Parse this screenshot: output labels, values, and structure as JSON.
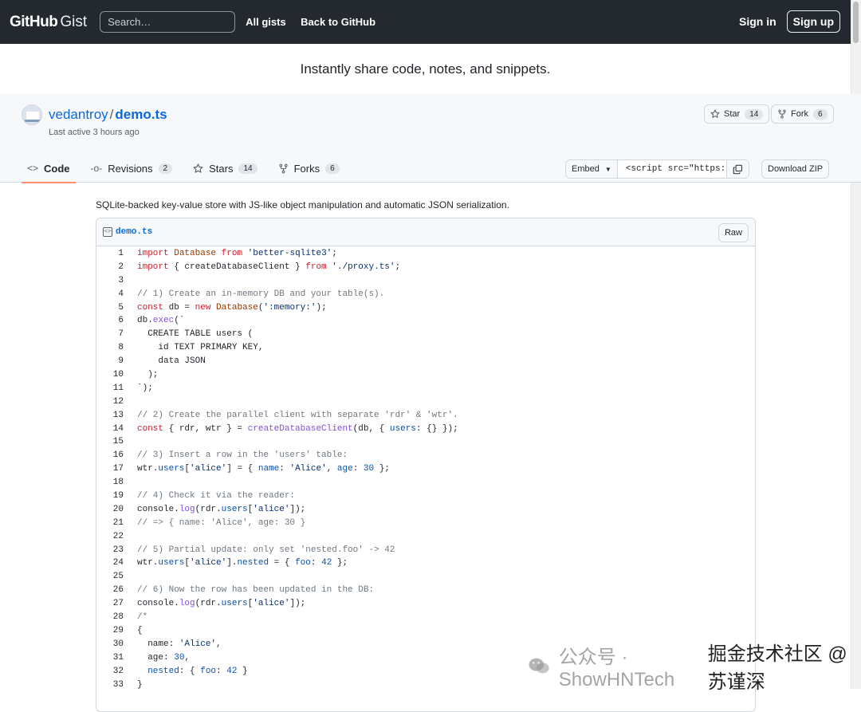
{
  "header": {
    "logo_main": "GitHub",
    "logo_sub": "Gist",
    "search_placeholder": "Search…",
    "nav": [
      "All gists",
      "Back to GitHub"
    ],
    "sign_in": "Sign in",
    "sign_up": "Sign up"
  },
  "tagline": "Instantly share code, notes, and snippets.",
  "gist": {
    "owner": "vedantroy",
    "separator": "/",
    "filename": "demo.ts",
    "last_active": "Last active 3 hours ago",
    "star_label": "Star",
    "star_count": "14",
    "fork_label": "Fork",
    "fork_count": "6"
  },
  "tabs": [
    {
      "label": "Code",
      "icon": "code-icon",
      "count": ""
    },
    {
      "label": "Revisions",
      "icon": "commit-icon",
      "count": "2"
    },
    {
      "label": "Stars",
      "icon": "star-icon",
      "count": "14"
    },
    {
      "label": "Forks",
      "icon": "fork-icon",
      "count": "6"
    }
  ],
  "embed": {
    "select_label": "Embed",
    "url": "<script src=\"https:/",
    "download_label": "Download ZIP"
  },
  "description": "SQLite-backed key-value store with JS-like object manipulation and automatic JSON serialization.",
  "file": {
    "name": "demo.ts",
    "raw_label": "Raw"
  },
  "code_lines": [
    "import Database from 'better-sqlite3';",
    "import { createDatabaseClient } from './proxy.ts';",
    "",
    "// 1) Create an in-memory DB and your table(s).",
    "const db = new Database(':memory:');",
    "db.exec(`",
    "  CREATE TABLE users (",
    "    id TEXT PRIMARY KEY,",
    "    data JSON",
    "  );",
    "`);",
    "",
    "// 2) Create the parallel client with separate 'rdr' & 'wtr'.",
    "const { rdr, wtr } = createDatabaseClient(db, { users: {} });",
    "",
    "// 3) Insert a row in the 'users' table:",
    "wtr.users['alice'] = { name: 'Alice', age: 30 };",
    "",
    "// 4) Check it via the reader:",
    "console.log(rdr.users['alice']);",
    "// => { name: 'Alice', age: 30 }",
    "",
    "// 5) Partial update: only set 'nested.foo' -> 42",
    "wtr.users['alice'].nested = { foo: 42 };",
    "",
    "// 6) Now the row has been updated in the DB:",
    "console.log(rdr.users['alice']);",
    "/*",
    "{",
    "  name: 'Alice',",
    "  age: 30,",
    "  nested: { foo: 42 }",
    "}"
  ],
  "watermark": {
    "left": "公众号 · ShowHNTech",
    "right": "掘金技术社区 @ 苏谨深"
  }
}
